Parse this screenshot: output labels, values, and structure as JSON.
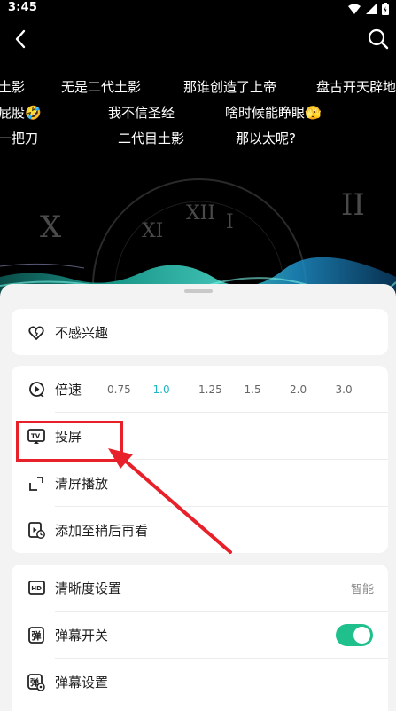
{
  "status_bar": {
    "time": "3:45",
    "icons": [
      "wifi-icon",
      "signal-icon",
      "battery-icon"
    ]
  },
  "video": {
    "danmaku": [
      "土影",
      "无是二代土影",
      "那谁创造了上帝",
      "盘古开天辟地",
      "屁股🤣",
      "我不信圣经",
      "啥时候能睁眼🫣",
      "一把刀",
      "二代目土影",
      "那以太呢?"
    ],
    "clock_numerals": [
      "XII",
      "I",
      "II",
      "X",
      "XI"
    ]
  },
  "sheet": {
    "not_interested": "不感兴趣",
    "speed_label": "倍速",
    "speeds": [
      "0.75",
      "1.0",
      "1.25",
      "1.5",
      "2.0",
      "3.0"
    ],
    "speed_selected": "1.0",
    "cast_label": "投屏",
    "clear_play_label": "清屏播放",
    "watch_later_label": "添加至稍后再看",
    "quality_label": "清晰度设置",
    "quality_value": "智能",
    "danmaku_toggle_label": "弹幕开关",
    "danmaku_toggle_on": true,
    "danmaku_settings_label": "弹幕设置"
  },
  "colors": {
    "accent": "#1fb7c8",
    "toggle_on": "#20c08c",
    "annotation": "#e8202a"
  }
}
